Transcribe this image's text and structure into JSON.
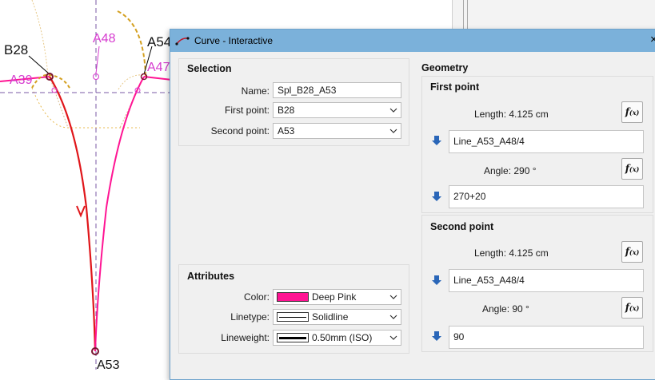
{
  "canvas": {
    "point_labels": {
      "b28": "B28",
      "a48": "A48",
      "a54": "A54",
      "a47": "A47",
      "a39": "A39",
      "a53": "A53"
    }
  },
  "dialog": {
    "title": "Curve - Interactive",
    "close_glyph": "×",
    "selection": {
      "title": "Selection",
      "name_label": "Name:",
      "name_value": "Spl_B28_A53",
      "first_point_label": "First point:",
      "first_point_value": "B28",
      "second_point_label": "Second point:",
      "second_point_value": "A53"
    },
    "attributes": {
      "title": "Attributes",
      "color_label": "Color:",
      "color_value": "Deep Pink",
      "color_swatch": "#ff1493",
      "linetype_label": "Linetype:",
      "linetype_value": "Solidline",
      "lineweight_label": "Lineweight:",
      "lineweight_value": "0.50mm (ISO)"
    },
    "geometry": {
      "title": "Geometry",
      "first_point": {
        "title": "First point",
        "length_text": "Length: 4.125 cm",
        "length_formula": "Line_A53_A48/4",
        "angle_text": "Angle: 290 °",
        "angle_formula": "270+20"
      },
      "second_point": {
        "title": "Second point",
        "length_text": "Length: 4.125 cm",
        "length_formula": "Line_A53_A48/4",
        "angle_text": "Angle: 90 °",
        "angle_formula": "90"
      },
      "fx_label": "f",
      "fx_sub": "(x)"
    }
  },
  "colors": {
    "dialog_bg": "#f0f0f0",
    "titlebar": "#7bb1da",
    "curve_red": "#e0161a",
    "curve_pink": "#ff1493",
    "label_magenta": "#d63acf",
    "guide_purple": "#7a5aa6",
    "arc_gold": "#d4a020",
    "point_maroon": "#7a1530",
    "arrow_blue": "#2a66b8"
  }
}
